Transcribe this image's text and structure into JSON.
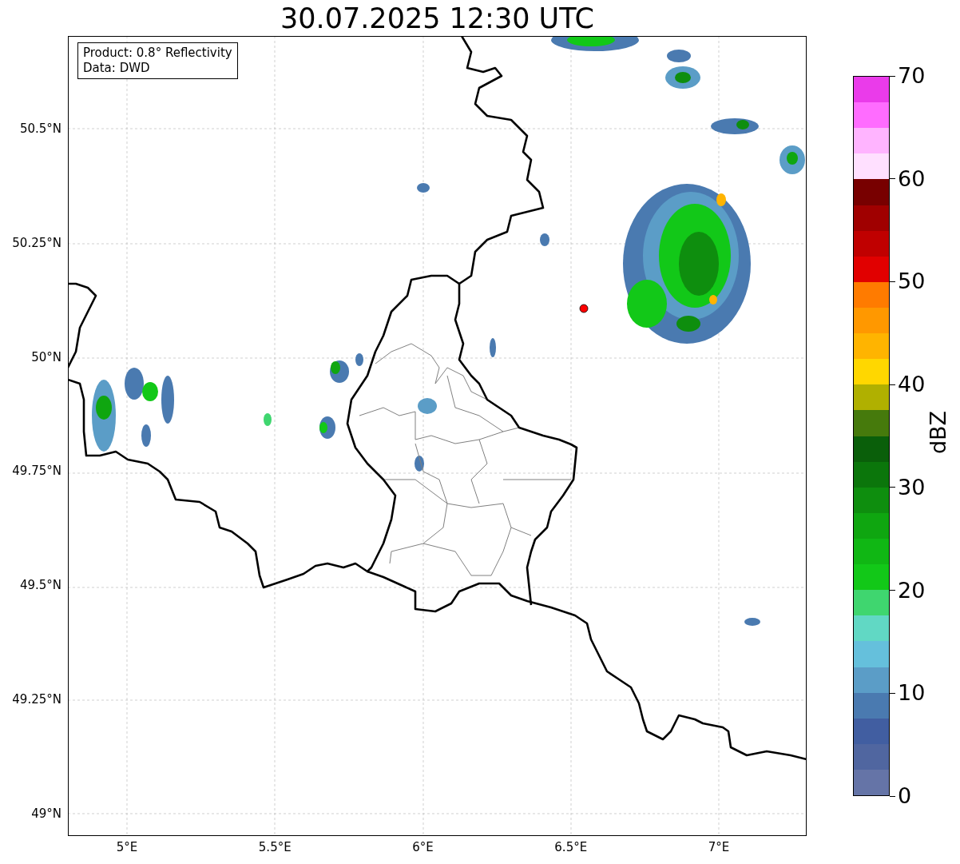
{
  "title": "30.07.2025 12:30 UTC",
  "info_box": {
    "lines": [
      "Product: 0.8° Reflectivity",
      "Data: DWD"
    ]
  },
  "map": {
    "lat_labels": [
      "50.5°N",
      "50.25°N",
      "50°N",
      "49.75°N",
      "49.5°N",
      "49.25°N",
      "49°N"
    ],
    "lon_labels": [
      "5°E",
      "5.5°E",
      "6°E",
      "6.5°E",
      "7°E"
    ]
  },
  "colorbar": {
    "label": "dBZ",
    "tick_labels": [
      "70",
      "60",
      "50",
      "40",
      "30",
      "20",
      "10",
      "0"
    ],
    "bands": [
      {
        "color": "#ea3bea"
      },
      {
        "color": "#ff6cff"
      },
      {
        "color": "#ffb4ff"
      },
      {
        "color": "#ffe0ff"
      },
      {
        "color": "#780000"
      },
      {
        "color": "#a00000"
      },
      {
        "color": "#c00000"
      },
      {
        "color": "#e10000"
      },
      {
        "color": "#ff7b00"
      },
      {
        "color": "#ff9800"
      },
      {
        "color": "#ffb400"
      },
      {
        "color": "#ffd700"
      },
      {
        "color": "#b0b000"
      },
      {
        "color": "#467a0c"
      },
      {
        "color": "#0a5f0a"
      },
      {
        "color": "#0b760b"
      },
      {
        "color": "#0e8e0e"
      },
      {
        "color": "#0fa610"
      },
      {
        "color": "#10b714"
      },
      {
        "color": "#12c818"
      },
      {
        "color": "#3fd66f"
      },
      {
        "color": "#61d8c4"
      },
      {
        "color": "#65c0dc"
      },
      {
        "color": "#5b9dc7"
      },
      {
        "color": "#4a7ab0"
      },
      {
        "color": "#415ea1"
      },
      {
        "color": "#5066a0"
      },
      {
        "color": "#6574a7"
      }
    ]
  }
}
